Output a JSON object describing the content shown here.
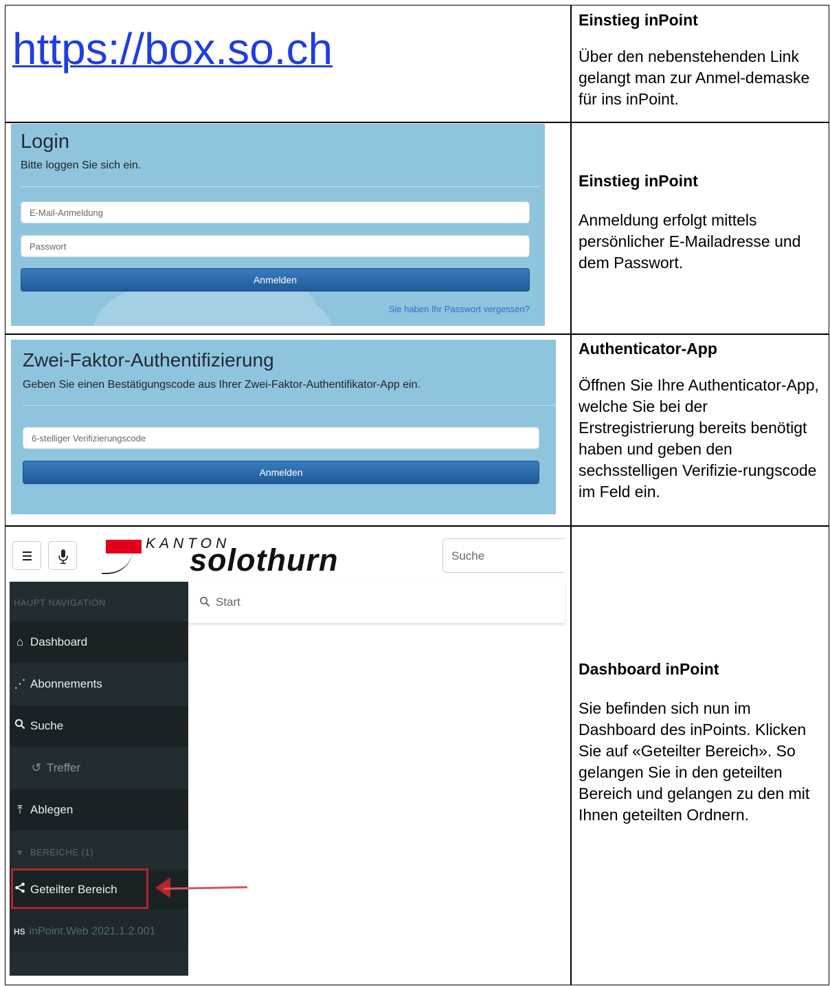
{
  "row1": {
    "link": "https://box.so.ch",
    "heading": "Einstieg inPoint",
    "text": "Über den nebenstehenden Link gelangt man zur Anmel-demaske für ins inPoint."
  },
  "row2": {
    "login_title": "Login",
    "login_subtitle": "Bitte loggen Sie sich ein.",
    "email_placeholder": "E-Mail-Anmeldung",
    "password_placeholder": "Passwort",
    "login_button": "Anmelden",
    "forgot_link": "Sie haben Ihr Passwort vergessen?",
    "heading": "Einstieg inPoint",
    "text": "Anmeldung erfolgt mittels persönlicher E-Mailadresse und dem Passwort."
  },
  "row3": {
    "title": "Zwei-Faktor-Authentifizierung",
    "subtitle": "Geben Sie einen Bestätigungscode aus Ihrer Zwei-Faktor-Authentifikator-App ein.",
    "code_placeholder": "6-stelliger Verifizierungscode",
    "button": "Anmelden",
    "heading": "Authenticator-App",
    "text": "Öffnen Sie Ihre Authenticator-App, welche Sie bei der Erstregistrierung bereits benötigt haben und geben den sechsstelligen Verifizie-rungscode im Feld ein."
  },
  "row4": {
    "brand_small": "KANTON",
    "brand_large": "solothurn",
    "top_search_placeholder": "Suche",
    "content_search_placeholder": "Start",
    "nav": {
      "header": "Haupt Navigation",
      "dashboard": "Dashboard",
      "abonnements": "Abonnements",
      "suche": "Suche",
      "treffer": "Treffer",
      "ablegen": "Ablegen",
      "bereiche": "Bereiche (1)",
      "geteilter": "Geteilter Bereich",
      "version_badge": "HS",
      "version": "inPoint.Web 2021.1.2.001"
    },
    "heading": "Dashboard inPoint",
    "text": "Sie befinden sich nun im Dashboard des inPoints. Klicken Sie auf «Geteilter Bereich». So gelangen Sie in den geteilten Bereich und gelangen zu den mit Ihnen geteilten Ordnern."
  },
  "colors": {
    "panel_blue": "#8fc4de",
    "button_blue": "#2a68a8",
    "sidebar": "#222d32",
    "highlight_red": "#b3262b",
    "link_blue": "#1f3de0",
    "flag_red": "#e3001b"
  }
}
